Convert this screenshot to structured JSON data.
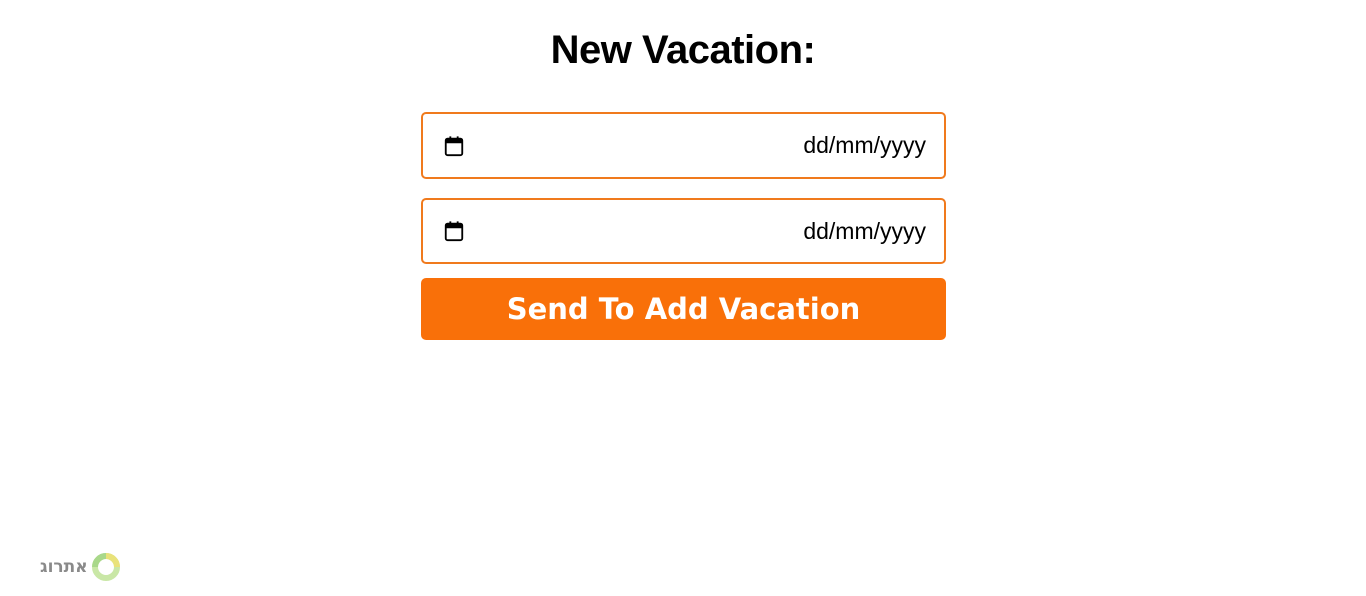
{
  "form": {
    "title": "New Vacation:",
    "start_date": {
      "placeholder": "dd/mm/yyyy",
      "icon": "calendar-icon"
    },
    "end_date": {
      "placeholder": "dd/mm/yyyy",
      "icon": "calendar-icon"
    },
    "submit_label": "Send To Add Vacation"
  },
  "footer": {
    "logo_text": "אתרוג"
  },
  "colors": {
    "accent": "#f97009",
    "field_border": "#f07a1d",
    "logo_text": "#8a8a8a"
  }
}
